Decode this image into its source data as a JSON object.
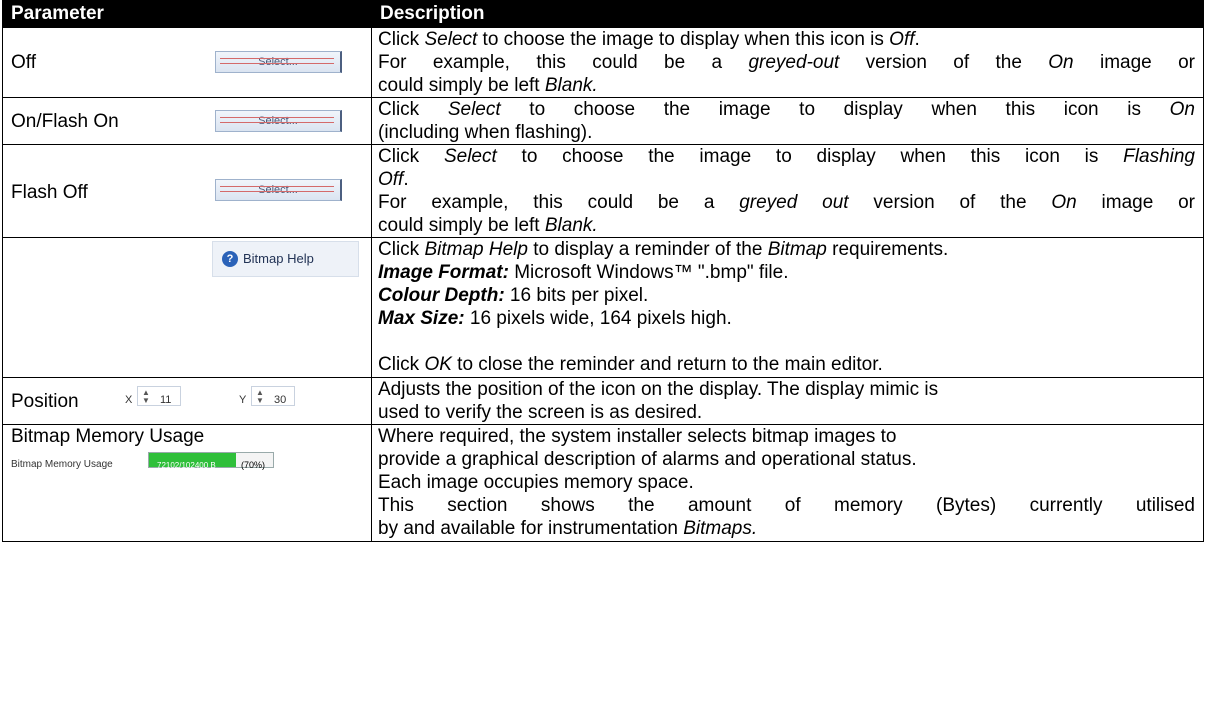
{
  "header": {
    "col_parameter": "Parameter",
    "col_description": "Description"
  },
  "rows": {
    "off": {
      "label": "Off",
      "button": "Select...",
      "d1": [
        "Click ",
        "Select",
        " to choose the image to display when this icon is ",
        "Off",
        "."
      ],
      "d2": [
        "For example, this could be a ",
        "greyed-out",
        " version of the ",
        "On",
        " image or"
      ],
      "d3": [
        "could simply be left ",
        "Blank."
      ]
    },
    "on": {
      "label": "On/Flash On",
      "button": "Select...",
      "d1": [
        "Click ",
        "Select",
        " to choose the image to display when this icon is ",
        "On"
      ],
      "d2": [
        "(including when flashing)."
      ]
    },
    "flashoff": {
      "label": "Flash Off",
      "button": "Select...",
      "d1": [
        "Click ",
        "Select",
        " to choose the image to display when this icon is ",
        "Flashing"
      ],
      "d2": [
        "Off",
        "."
      ],
      "d3": [
        "For example, this could be a ",
        "greyed out",
        " version of the ",
        "On",
        " image or"
      ],
      "d4": [
        "could simply be left ",
        "Blank."
      ]
    },
    "bmhelp": {
      "button": "Bitmap Help",
      "d1": [
        "Click ",
        "Bitmap Help",
        " to display a reminder of the ",
        "Bitmap",
        " requirements."
      ],
      "d2": [
        "Image Format:",
        " Microsoft Windows™ \".bmp\" file."
      ],
      "d3": [
        "Colour Depth:",
        " 16 bits per pixel."
      ],
      "d4": [
        "Max Size:",
        " 16 pixels wide, 164 pixels high."
      ],
      "d5": [
        "Click ",
        "OK",
        " to close the reminder and return to the main editor."
      ]
    },
    "position": {
      "label": "Position",
      "x_label": "X",
      "x_value": "11",
      "y_label": "Y",
      "y_value": "30",
      "d1": "Adjusts the position of the icon on the display. The display mimic is",
      "d2": "used to verify the screen is as desired."
    },
    "memory": {
      "label": "Bitmap Memory Usage",
      "widget_label": "Bitmap Memory Usage",
      "bar_text": "72102/102400 B",
      "percent_text": "(70%)",
      "fill_fraction": 0.7,
      "d1": "Where required, the system installer selects bitmap images to",
      "d2": "provide a graphical description of alarms and operational status.",
      "d3": "Each image occupies memory space.",
      "d4": [
        "This section shows the amount of memory (Bytes) currently utilised"
      ],
      "d5": [
        "by and available for instrumentation ",
        "Bitmaps."
      ]
    }
  },
  "colors": {
    "header_bg": "#000000",
    "header_fg": "#ffffff",
    "memory_fill": "#2fbf3a",
    "button_accent": "#4c5f80"
  }
}
